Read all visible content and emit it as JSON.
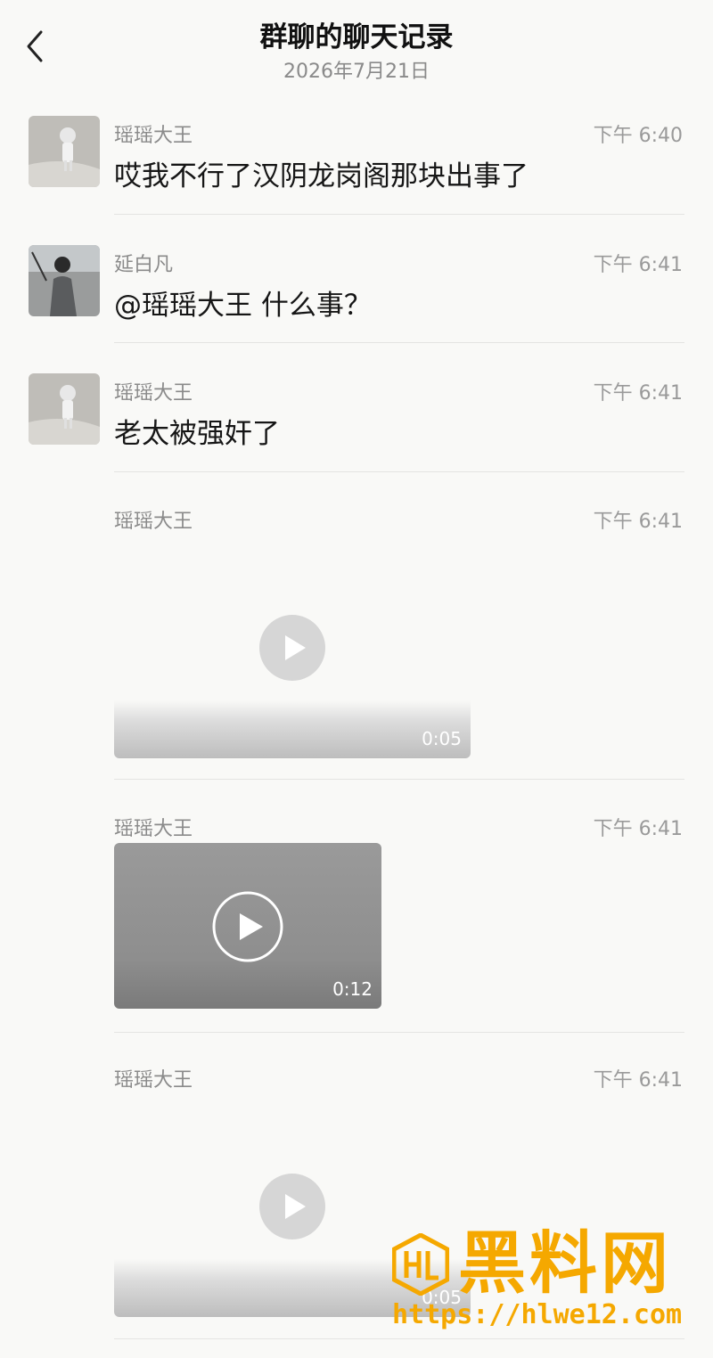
{
  "header": {
    "title": "群聊的聊天记录",
    "date": "2026年7月21日"
  },
  "messages": [
    {
      "sender": "瑶瑶大王",
      "time": "下午 6:40",
      "text": "哎我不行了汉阴龙岗阁那块出事了"
    },
    {
      "sender": "延白凡",
      "time": "下午 6:41",
      "text": "@瑶瑶大王 什么事？"
    },
    {
      "sender": "瑶瑶大王",
      "time": "下午 6:41",
      "text": "老太被强奸了"
    },
    {
      "sender": "瑶瑶大王",
      "time": "下午 6:41",
      "video_duration": "0:05"
    },
    {
      "sender": "瑶瑶大王",
      "time": "下午 6:41",
      "video_duration": "0:12"
    },
    {
      "sender": "瑶瑶大王",
      "time": "下午 6:41",
      "video_duration": "0:05"
    }
  ],
  "watermark": {
    "name": "黑料网",
    "url": "https://hlwe12.com"
  },
  "icons": {
    "back": "chevron-left-icon",
    "play": "play-icon"
  },
  "colors": {
    "background": "#f9f9f7",
    "watermark": "#f5a800"
  }
}
